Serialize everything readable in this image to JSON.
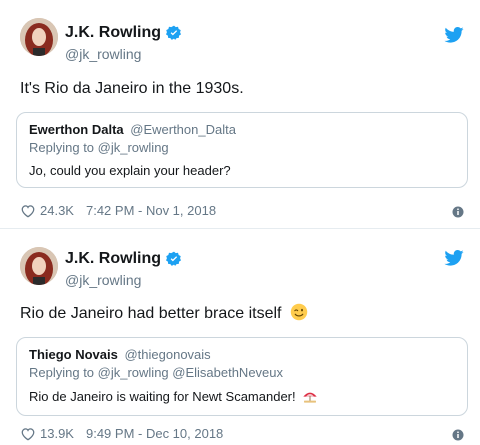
{
  "tweets": [
    {
      "author": "J.K. Rowling",
      "handle": "@jk_rowling",
      "text": "It's Rio da Janeiro in the 1930s.",
      "quote": {
        "name": "Ewerthon Dalta",
        "handle": "@Ewerthon_Dalta",
        "replying": "Replying to @jk_rowling",
        "text": "Jo, could you explain your header?"
      },
      "likes": "24.3K",
      "timestamp": "7:42 PM - Nov 1, 2018"
    },
    {
      "author": "J.K. Rowling",
      "handle": "@jk_rowling",
      "text": "Rio de Janeiro had better brace itself",
      "text_emoji": "winking-face",
      "quote": {
        "name": "Thiego Novais",
        "handle": "@thiegonovais",
        "replying": "Replying to @jk_rowling @ElisabethNeveux",
        "text": "Rio de Janeiro is waiting for Newt Scamander!",
        "text_emoji": "beach-umbrella"
      },
      "likes": "13.9K",
      "timestamp": "9:49 PM - Dec 10, 2018"
    }
  ],
  "colors": {
    "verified": "#1da1f2",
    "twitter_bird": "#1da1f2",
    "secondary_text": "#657786",
    "border": "#ccd6dd"
  },
  "icons": [
    "avatar",
    "verified-badge-icon",
    "twitter-bird-icon",
    "heart-icon",
    "info-icon"
  ]
}
